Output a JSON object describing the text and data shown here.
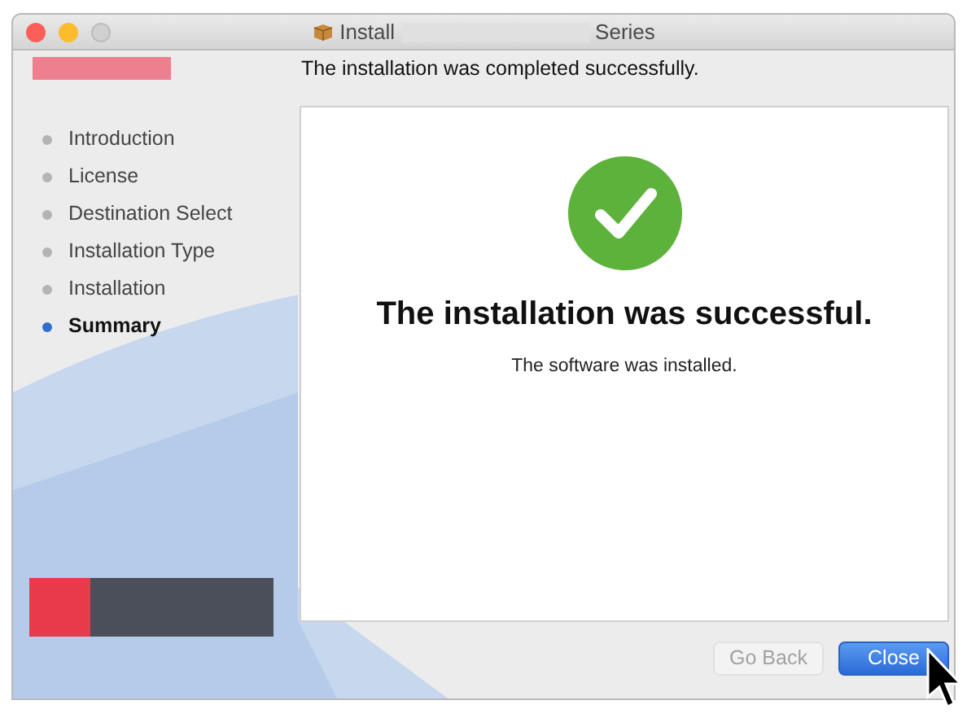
{
  "window": {
    "title_prefix": "Install",
    "title_suffix": "Series"
  },
  "header": "The installation was completed successfully.",
  "steps": [
    {
      "label": "Introduction",
      "selected": false
    },
    {
      "label": "License",
      "selected": false
    },
    {
      "label": "Destination Select",
      "selected": false
    },
    {
      "label": "Installation Type",
      "selected": false
    },
    {
      "label": "Installation",
      "selected": false
    },
    {
      "label": "Summary",
      "selected": true
    }
  ],
  "result": {
    "title": "The installation was successful.",
    "message": "The software was installed."
  },
  "buttons": [
    {
      "label": "Go Back",
      "kind": "secondary",
      "disabled": true
    },
    {
      "label": "Close",
      "kind": "primary",
      "disabled": false
    }
  ]
}
